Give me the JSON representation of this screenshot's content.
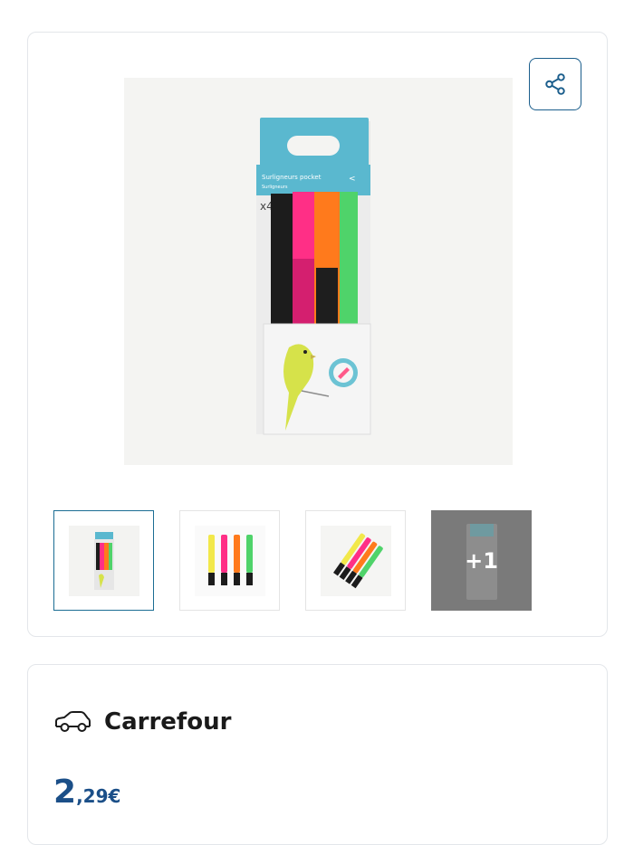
{
  "product": {
    "image_label": "Surligneurs pocket",
    "image_sublabel": "Surligneurs",
    "pack_count": "x4",
    "share_icon": "share-icon"
  },
  "gallery": {
    "thumbnails": [
      {
        "kind": "pack",
        "selected": true
      },
      {
        "kind": "markers-row",
        "selected": false
      },
      {
        "kind": "markers-angled",
        "selected": false
      },
      {
        "kind": "more",
        "selected": false
      }
    ],
    "more_label": "+1"
  },
  "offer": {
    "store_icon": "car-icon",
    "store_name": "Carrefour",
    "price_integer": "2",
    "price_decimal": ",29€"
  },
  "colors": {
    "accent": "#1b4f88",
    "selected_border": "#1b6d93",
    "pack_teal": "#5ab8cf",
    "marker_pink": "#ff2f86",
    "marker_orange": "#ff7a1c",
    "marker_green": "#4fd36a",
    "marker_yellow": "#f2e84a"
  }
}
